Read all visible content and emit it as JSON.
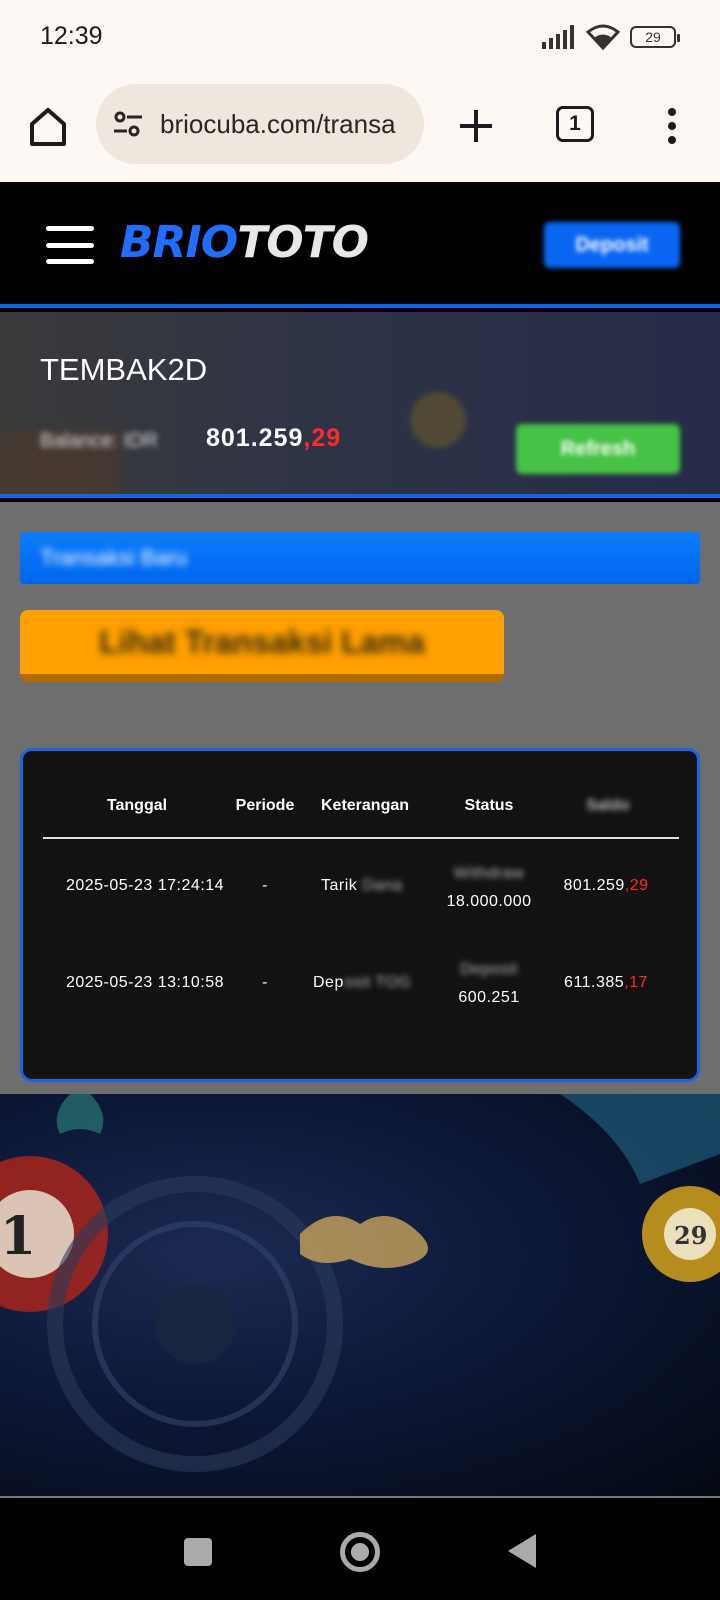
{
  "status_bar": {
    "time": "12:39",
    "battery": "29"
  },
  "browser": {
    "url": "briocuba.com/transa",
    "tab_count": "1"
  },
  "header": {
    "logo_part1": "BRIO",
    "logo_part2": "TOTO",
    "deposit_label": "Deposit"
  },
  "game": {
    "title": "TEMBAK2D",
    "balance_label": "Balance: IDR",
    "balance_main": "801.259",
    "balance_cents": ",29",
    "refresh_label": "Refresh"
  },
  "actions": {
    "new_transactions": "Transaksi Baru",
    "old_transactions": "Lihat Transaksi Lama"
  },
  "table": {
    "headers": [
      "Tanggal",
      "Periode",
      "Keterangan",
      "Status",
      "Saldo"
    ],
    "rows": [
      {
        "tanggal": "2025-05-23 17:24:14",
        "periode": "-",
        "keterangan": "Tarik",
        "keterangan_hidden": "Dana",
        "status_hidden": "Withdraw",
        "status_amount": "18.000.000",
        "saldo_main": "801.259",
        "saldo_cents": ",29"
      },
      {
        "tanggal": "2025-05-23 13:10:58",
        "periode": "-",
        "keterangan": "Dep",
        "keterangan_hidden": "osit TOG",
        "status_hidden": "Deposit",
        "status_amount": "600.251",
        "saldo_main": "611.385",
        "saldo_cents": ",17"
      }
    ]
  },
  "colors": {
    "accent_blue": "#1565e0",
    "deposit_blue": "#0a66f2",
    "refresh_green": "#46c246",
    "old_trans_orange": "#ffa000",
    "cents_red": "#ff2a2a"
  },
  "icons": [
    "home-icon",
    "tune-icon",
    "plus-icon",
    "tabs-icon",
    "more-vert-icon",
    "hamburger-icon",
    "signal-icon",
    "wifi-icon",
    "battery-icon"
  ]
}
